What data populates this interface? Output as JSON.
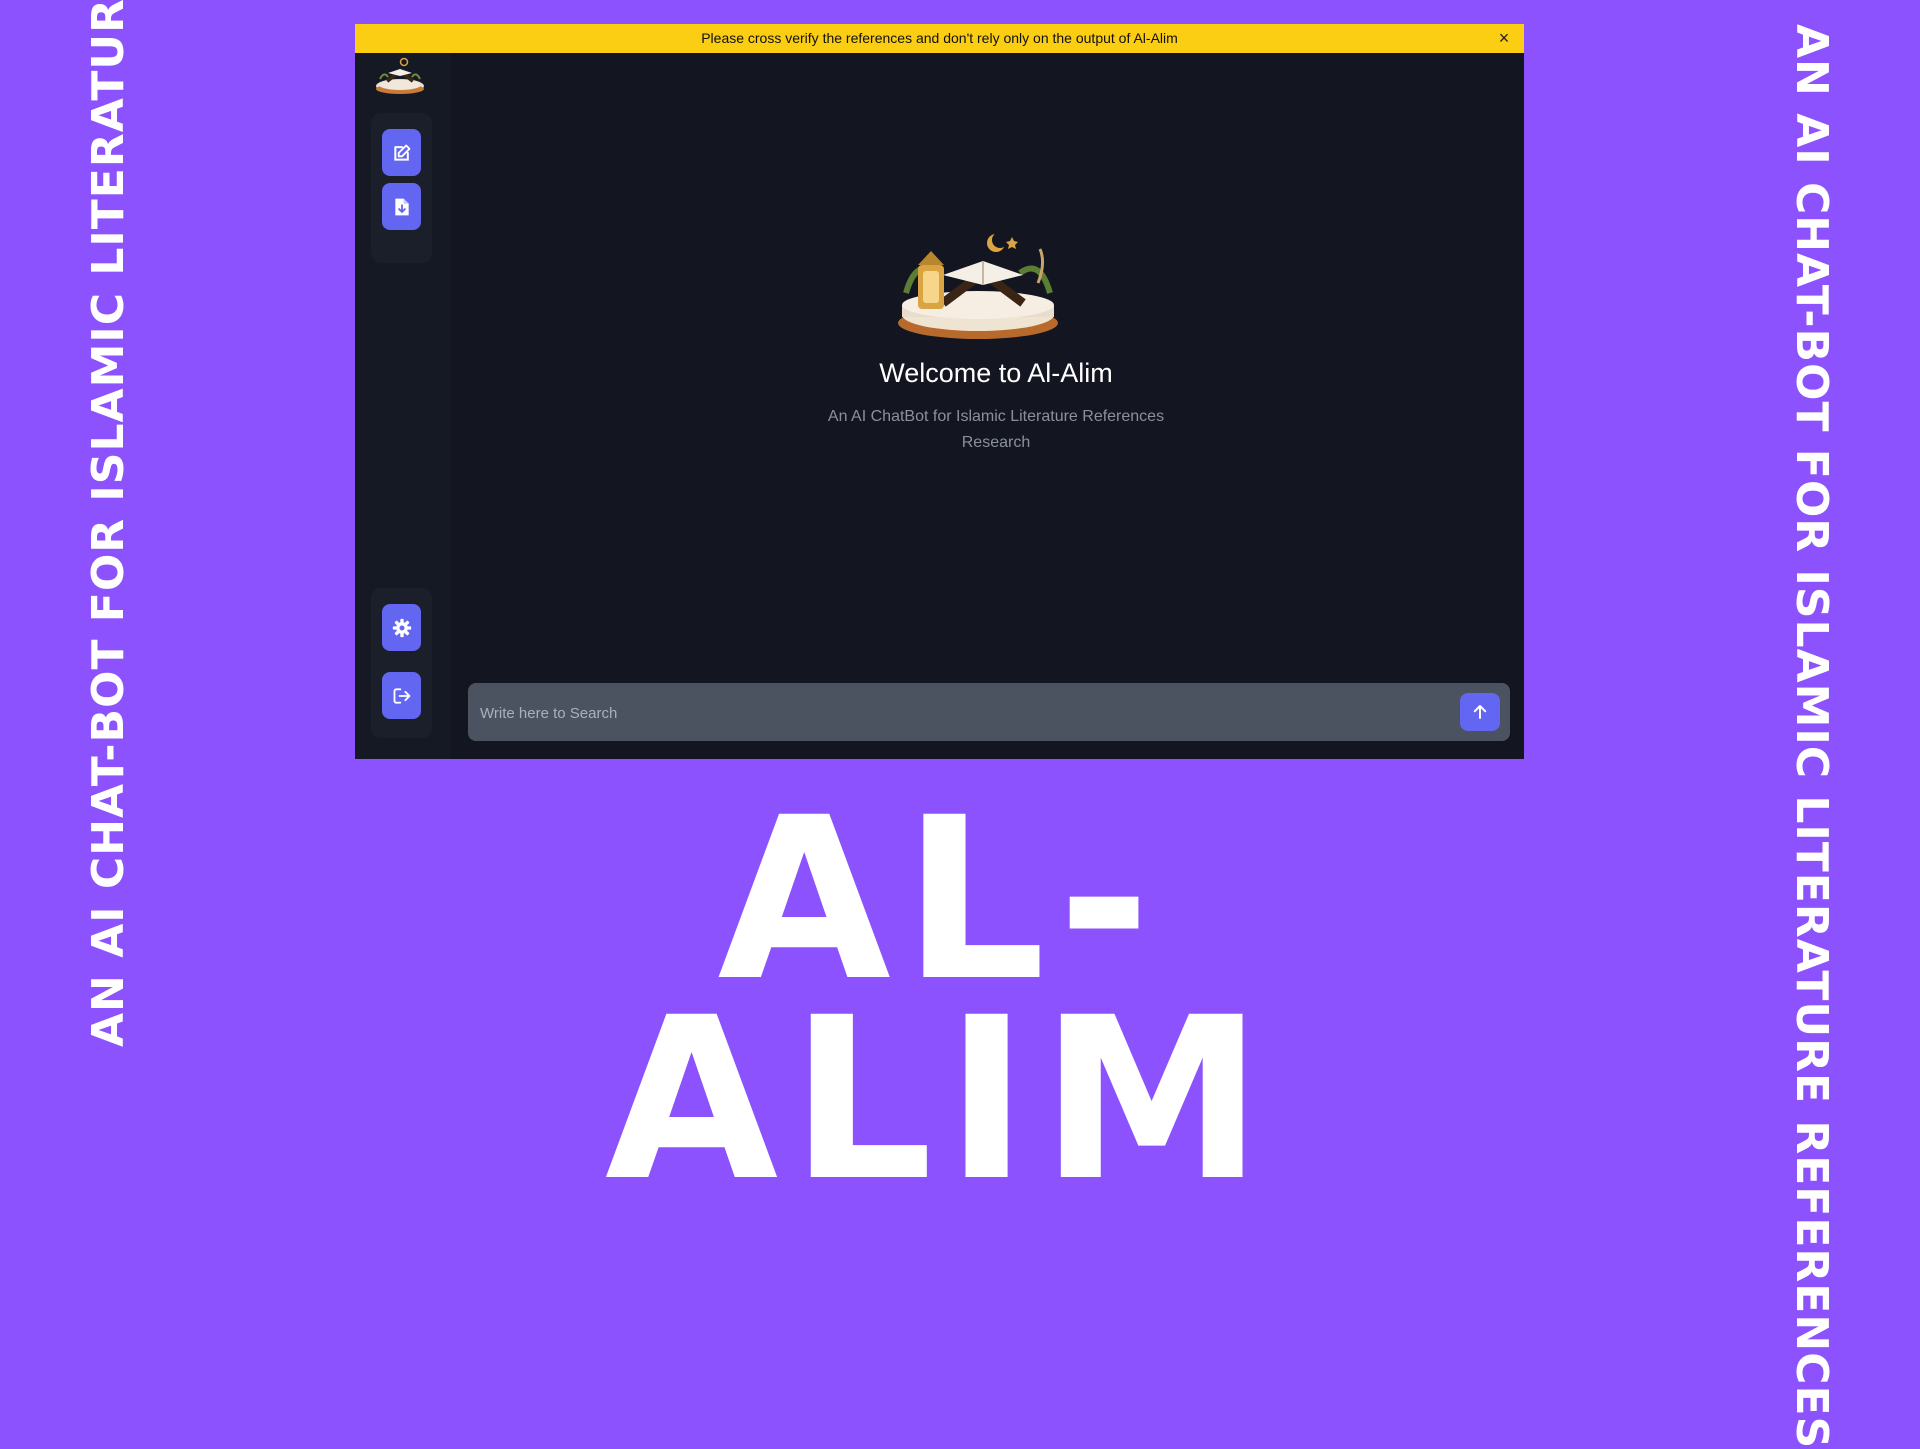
{
  "poster": {
    "side_text_left": "AN AI CHAT-BOT FOR ISLAMIC LITERATURE REFERENCES",
    "side_text_right": "AN AI CHAT-BOT FOR ISLAMIC LITERATURE REFERENCES",
    "big_title": "AL-ALIM",
    "background_color": "#8c52fe"
  },
  "app": {
    "banner": {
      "text": "Please cross verify the references and don't rely only on the output of Al-Alim",
      "close_label": "×",
      "color": "#fbcd13"
    },
    "sidebar": {
      "logo": "quran-stand-logo",
      "top_buttons": [
        {
          "icon": "edit-icon",
          "name": "new-chat-button"
        },
        {
          "icon": "file-download-icon",
          "name": "download-button"
        }
      ],
      "bottom_buttons": [
        {
          "icon": "gear-icon",
          "name": "settings-button"
        },
        {
          "icon": "logout-icon",
          "name": "logout-button"
        }
      ],
      "accent_color": "#6366f1"
    },
    "main": {
      "hero_image": "quran-on-stand-illustration",
      "welcome_title": "Welcome to Al-Alim",
      "subtitle": "An AI ChatBot for Islamic Literature References Research"
    },
    "search": {
      "placeholder": "Write here to Search",
      "value": "",
      "send_icon": "arrow-up-icon"
    }
  }
}
